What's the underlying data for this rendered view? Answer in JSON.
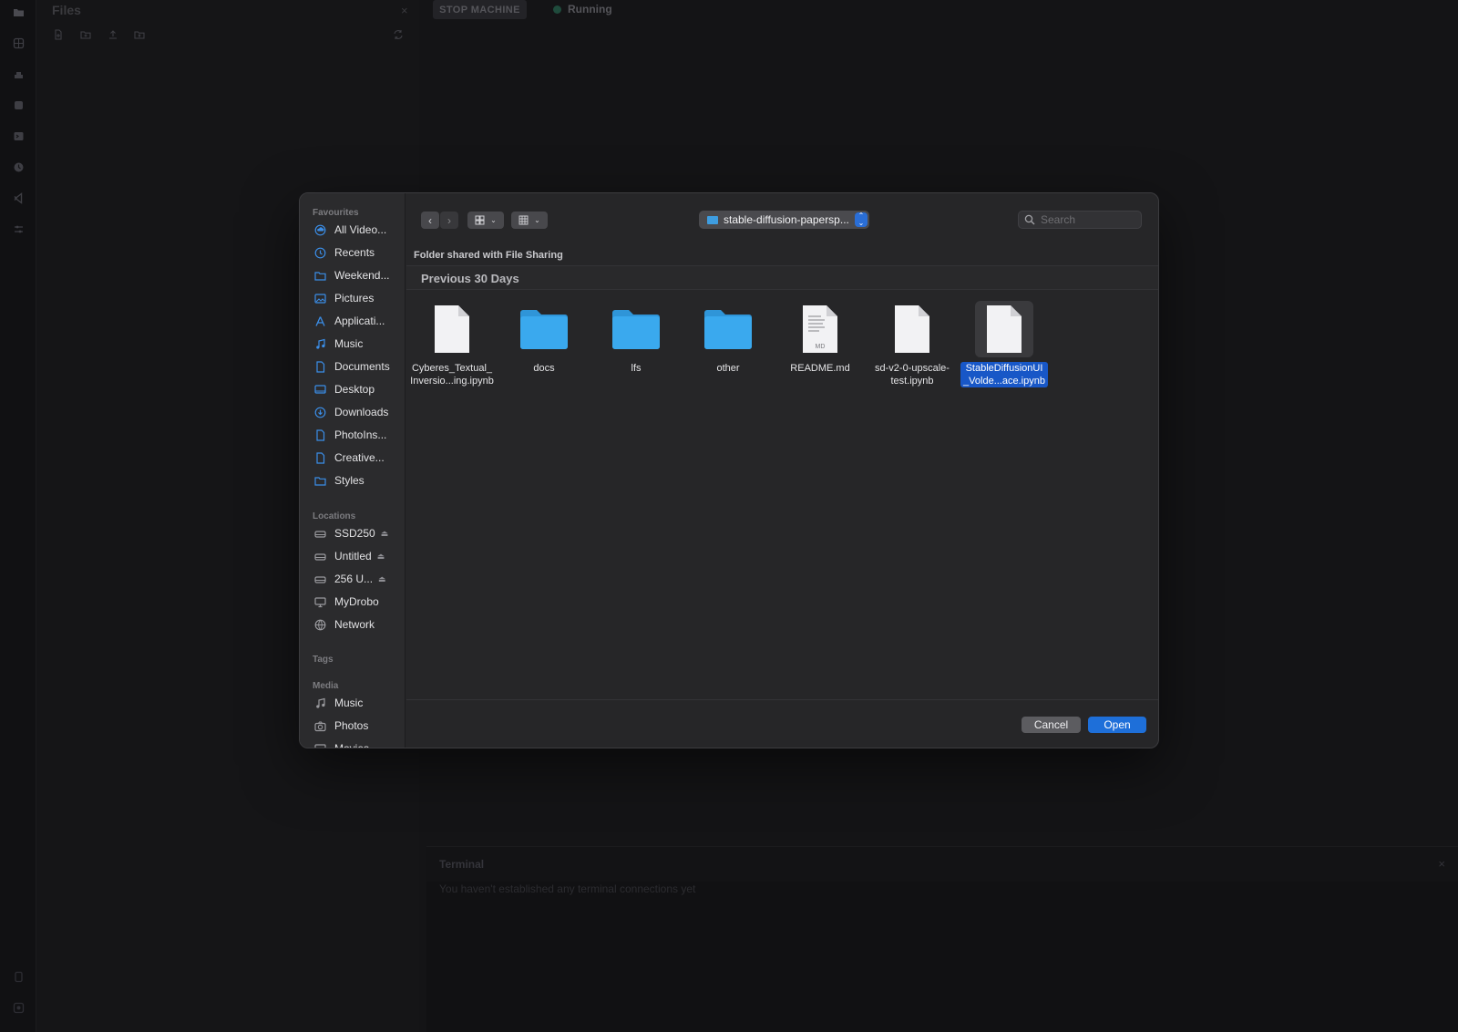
{
  "files_panel": {
    "title": "Files",
    "close": "×"
  },
  "topbar": {
    "stop_label": "STOP MACHINE",
    "status_label": "Running"
  },
  "terminal": {
    "title": "Terminal",
    "close": "×",
    "message": "You haven't established any terminal connections yet"
  },
  "dialog": {
    "sidebar": {
      "favourites_heading": "Favourites",
      "favourites": [
        {
          "label": "All Video...",
          "icon": "cloud-icon"
        },
        {
          "label": "Recents",
          "icon": "clock-icon"
        },
        {
          "label": "Weekend...",
          "icon": "folder-icon"
        },
        {
          "label": "Pictures",
          "icon": "photo-icon"
        },
        {
          "label": "Applicati...",
          "icon": "apps-icon"
        },
        {
          "label": "Music",
          "icon": "music-icon"
        },
        {
          "label": "Documents",
          "icon": "document-icon"
        },
        {
          "label": "Desktop",
          "icon": "desktop-icon"
        },
        {
          "label": "Downloads",
          "icon": "download-icon"
        },
        {
          "label": "PhotoIns...",
          "icon": "document-icon"
        },
        {
          "label": "Creative...",
          "icon": "document-icon"
        },
        {
          "label": "Styles",
          "icon": "folder-icon"
        }
      ],
      "locations_heading": "Locations",
      "locations": [
        {
          "label": "SSD250",
          "icon": "drive-icon",
          "eject": "⏏"
        },
        {
          "label": "Untitled",
          "icon": "drive-icon",
          "eject": "⏏"
        },
        {
          "label": "256 U...",
          "icon": "drive-icon",
          "eject": "⏏"
        },
        {
          "label": "MyDrobo",
          "icon": "monitor-icon"
        },
        {
          "label": "Network",
          "icon": "globe-icon"
        }
      ],
      "tags_heading": "Tags",
      "media_heading": "Media",
      "media": [
        {
          "label": "Music",
          "icon": "music-icon"
        },
        {
          "label": "Photos",
          "icon": "camera-icon"
        },
        {
          "label": "Movies",
          "icon": "film-icon"
        }
      ]
    },
    "toolbar": {
      "back": "‹",
      "forward": "›",
      "path": "stable-diffusion-papersp...",
      "search_placeholder": "Search"
    },
    "shared_label": "Folder shared with File Sharing",
    "section_title": "Previous 30 Days",
    "files": [
      {
        "name": "Cyberes_Textual_\nInversio...ing.ipynb",
        "kind": "document",
        "selected": false
      },
      {
        "name": "docs",
        "kind": "folder",
        "selected": false
      },
      {
        "name": "lfs",
        "kind": "folder",
        "selected": false
      },
      {
        "name": "other",
        "kind": "folder",
        "selected": false
      },
      {
        "name": "README.md",
        "kind": "markdown",
        "badge": "MD",
        "selected": false
      },
      {
        "name": "sd-v2-0-upscale-\ntest.ipynb",
        "kind": "document",
        "selected": false
      },
      {
        "name": "StableDiffusionUI\n_Volde...ace.ipynb",
        "kind": "document",
        "selected": true
      }
    ],
    "buttons": {
      "cancel": "Cancel",
      "open": "Open"
    },
    "colors": {
      "accent": "#1e6fd9",
      "folder": "#3aa9ee",
      "selection": "#1857c7"
    }
  }
}
